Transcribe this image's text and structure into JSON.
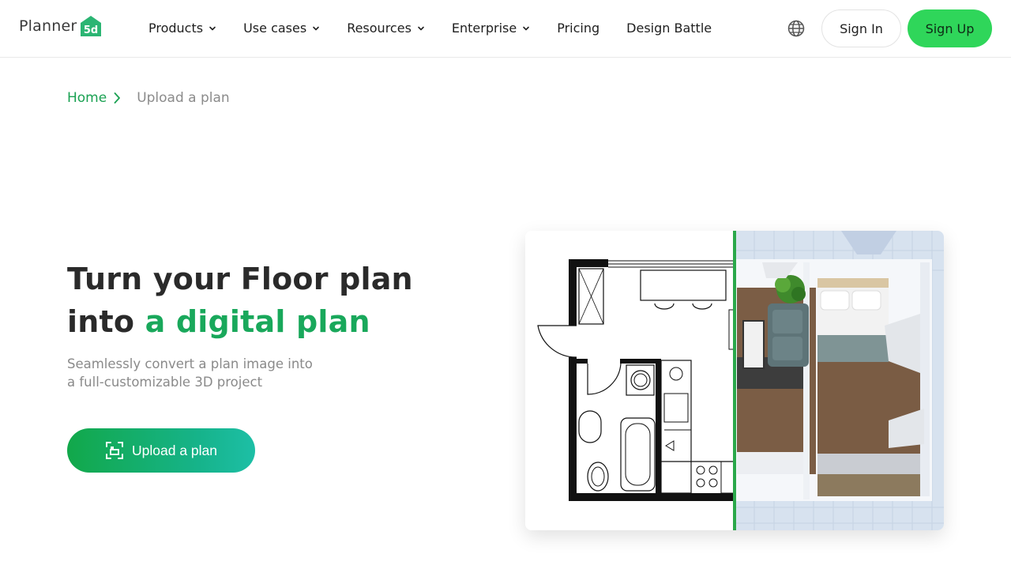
{
  "header": {
    "logo_text": "Planner",
    "logo_badge": "5d",
    "nav": [
      {
        "label": "Products",
        "has_dropdown": true
      },
      {
        "label": "Use cases",
        "has_dropdown": true
      },
      {
        "label": "Resources",
        "has_dropdown": true
      },
      {
        "label": "Enterprise",
        "has_dropdown": true
      },
      {
        "label": "Pricing",
        "has_dropdown": false
      },
      {
        "label": "Design Battle",
        "has_dropdown": false
      }
    ],
    "signin_label": "Sign In",
    "signup_label": "Sign Up",
    "language_icon": "globe-icon"
  },
  "breadcrumb": {
    "home": "Home",
    "current": "Upload a plan"
  },
  "hero": {
    "title_line1": "Turn your Floor plan",
    "title_line2_prefix": "into ",
    "title_line2_accent": "a digital plan",
    "subtitle_line1": "Seamlessly convert a plan image into",
    "subtitle_line2": "a full-customizable 3D project",
    "upload_label": "Upload a plan"
  },
  "colors": {
    "brand_green": "#2fd65a",
    "accent_green": "#19a85b",
    "link_green": "#1aa152"
  }
}
